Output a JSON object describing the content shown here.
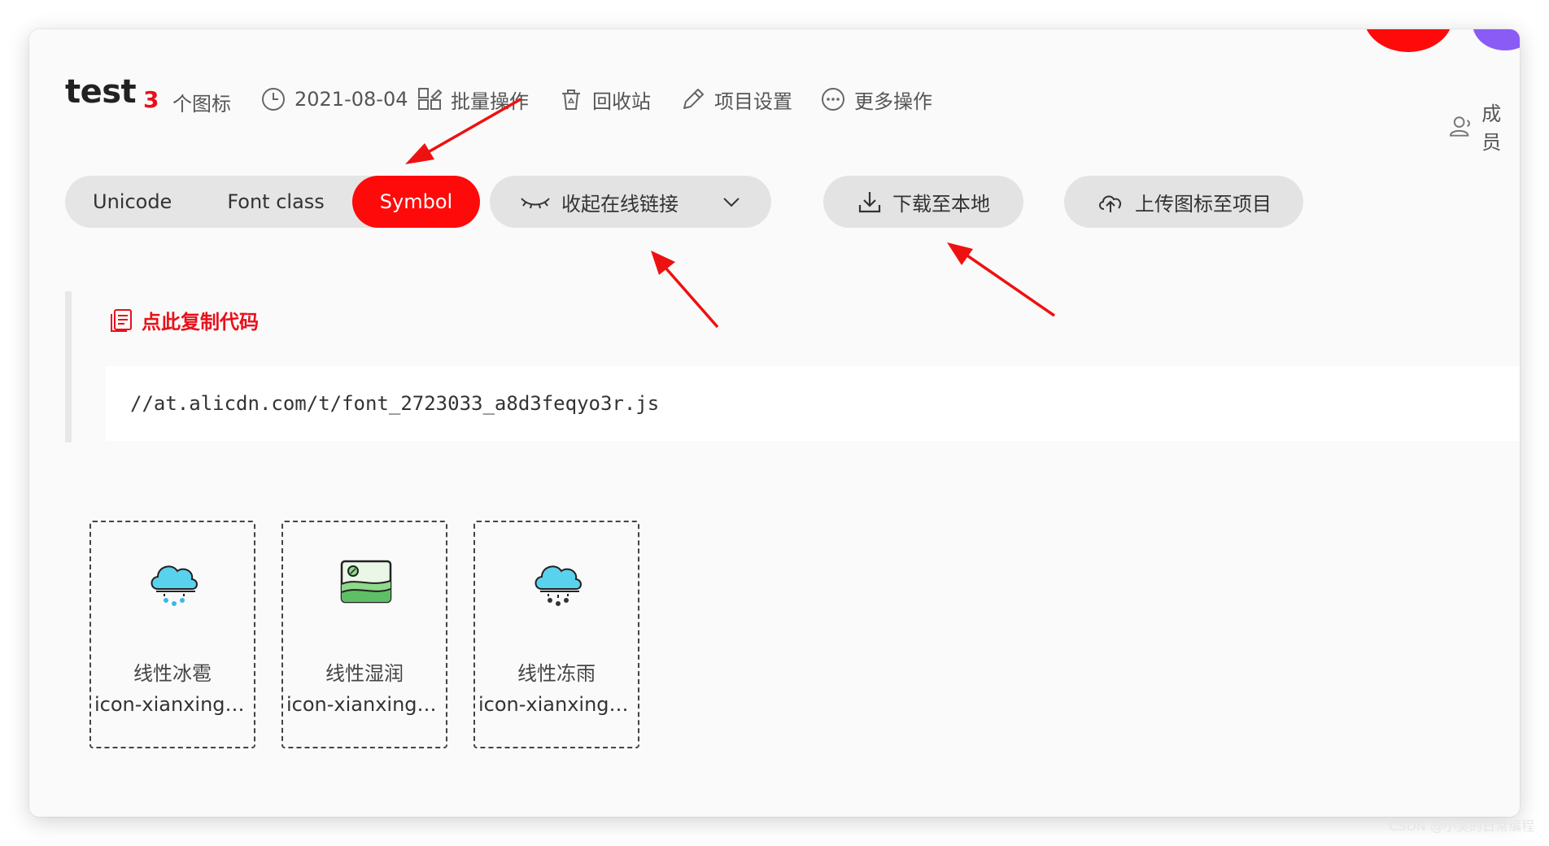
{
  "header": {
    "project_name": "test",
    "icon_count": "3",
    "icon_count_label": "个图标",
    "date": "2021-08-04",
    "batch_ops": "批量操作",
    "recycle_bin": "回收站",
    "project_settings": "项目设置",
    "more_ops": "更多操作",
    "members": "成员"
  },
  "tabs": [
    {
      "label": "Unicode",
      "active": false
    },
    {
      "label": "Font class",
      "active": false
    },
    {
      "label": "Symbol",
      "active": true
    }
  ],
  "actions": {
    "online_link": "收起在线链接",
    "download": "下载至本地",
    "upload": "上传图标至项目"
  },
  "code": {
    "copy_label": "点此复制代码",
    "url": "//at.alicdn.com/t/font_2723033_a8d3feqyo3r.js"
  },
  "icons": [
    {
      "name": "线性冰雹",
      "code": "icon-xianxingbin...",
      "glyph": "hail-cloud-icon"
    },
    {
      "name": "线性湿润",
      "code": "icon-xianxingshir...",
      "glyph": "landscape-icon"
    },
    {
      "name": "线性冻雨",
      "code": "icon-xianxingdon...",
      "glyph": "freezing-rain-cloud-icon"
    }
  ],
  "colors": {
    "accent": "#ff0a0a",
    "annotation_arrow": "#ee1111"
  },
  "watermark": "CSDN @小吴的日常编程"
}
